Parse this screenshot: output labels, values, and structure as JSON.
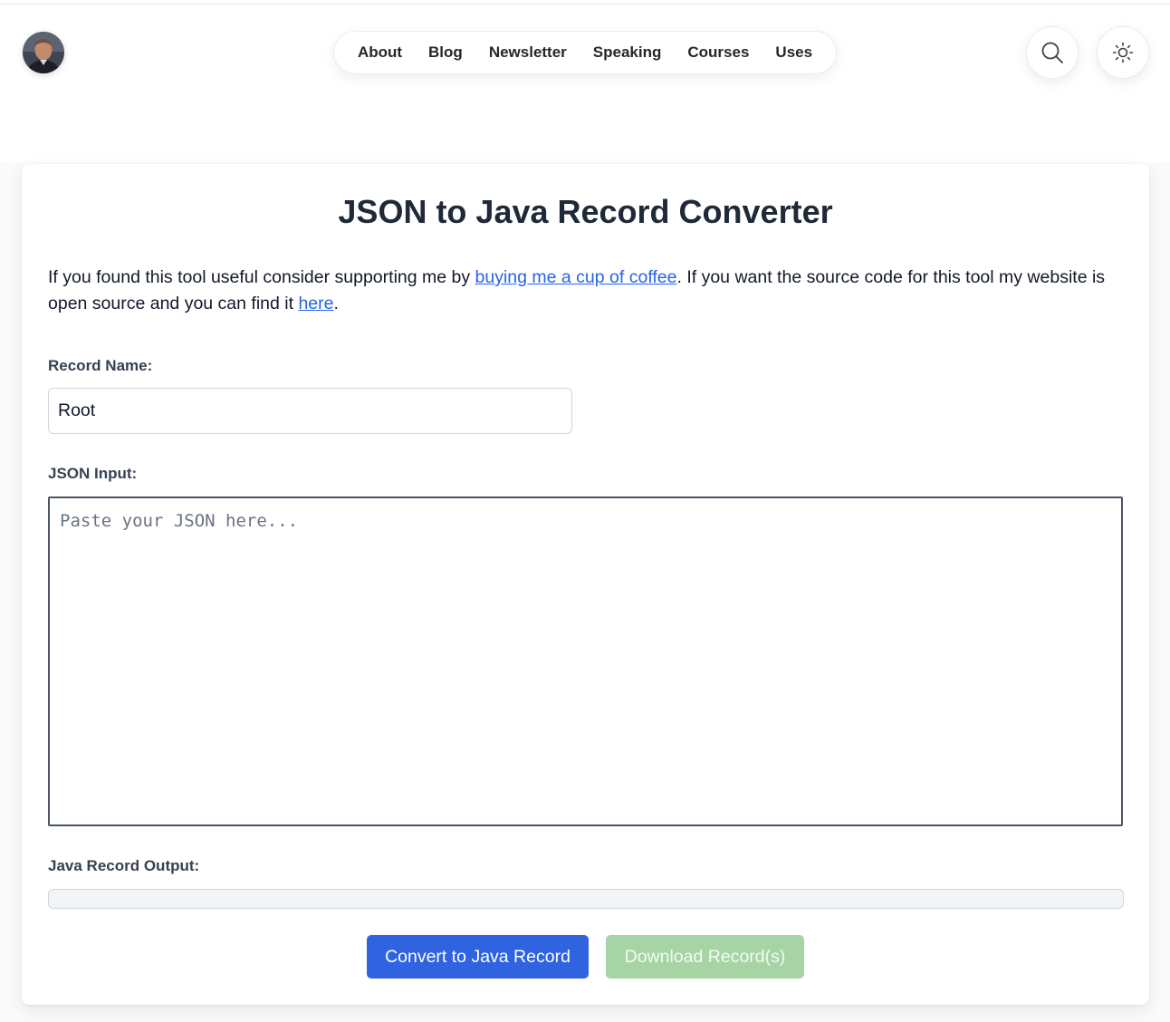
{
  "header": {
    "avatar_alt": "Profile photo",
    "nav": [
      {
        "label": "About"
      },
      {
        "label": "Blog"
      },
      {
        "label": "Newsletter"
      },
      {
        "label": "Speaking"
      },
      {
        "label": "Courses"
      },
      {
        "label": "Uses"
      }
    ],
    "icons": {
      "search": "search-icon",
      "theme": "sun-icon"
    }
  },
  "main": {
    "title": "JSON to Java Record Converter",
    "intro": {
      "text_before": "If you found this tool useful consider supporting me by ",
      "coffee_link": "buying me a cup of coffee",
      "text_middle": ". If you want the source code for this tool my website is open source and you can find it ",
      "here_link": "here",
      "text_after": "."
    },
    "record_name": {
      "label": "Record Name:",
      "value": "Root"
    },
    "json_input": {
      "label": "JSON Input:",
      "placeholder": "Paste your JSON here...",
      "value": ""
    },
    "output": {
      "label": "Java Record Output:",
      "value": ""
    },
    "buttons": {
      "convert": "Convert to Java Record",
      "download": "Download Record(s)"
    }
  },
  "colors": {
    "link": "#2563eb",
    "primary_button": "#2f63e0",
    "disabled_button": "#a6d4a5"
  }
}
